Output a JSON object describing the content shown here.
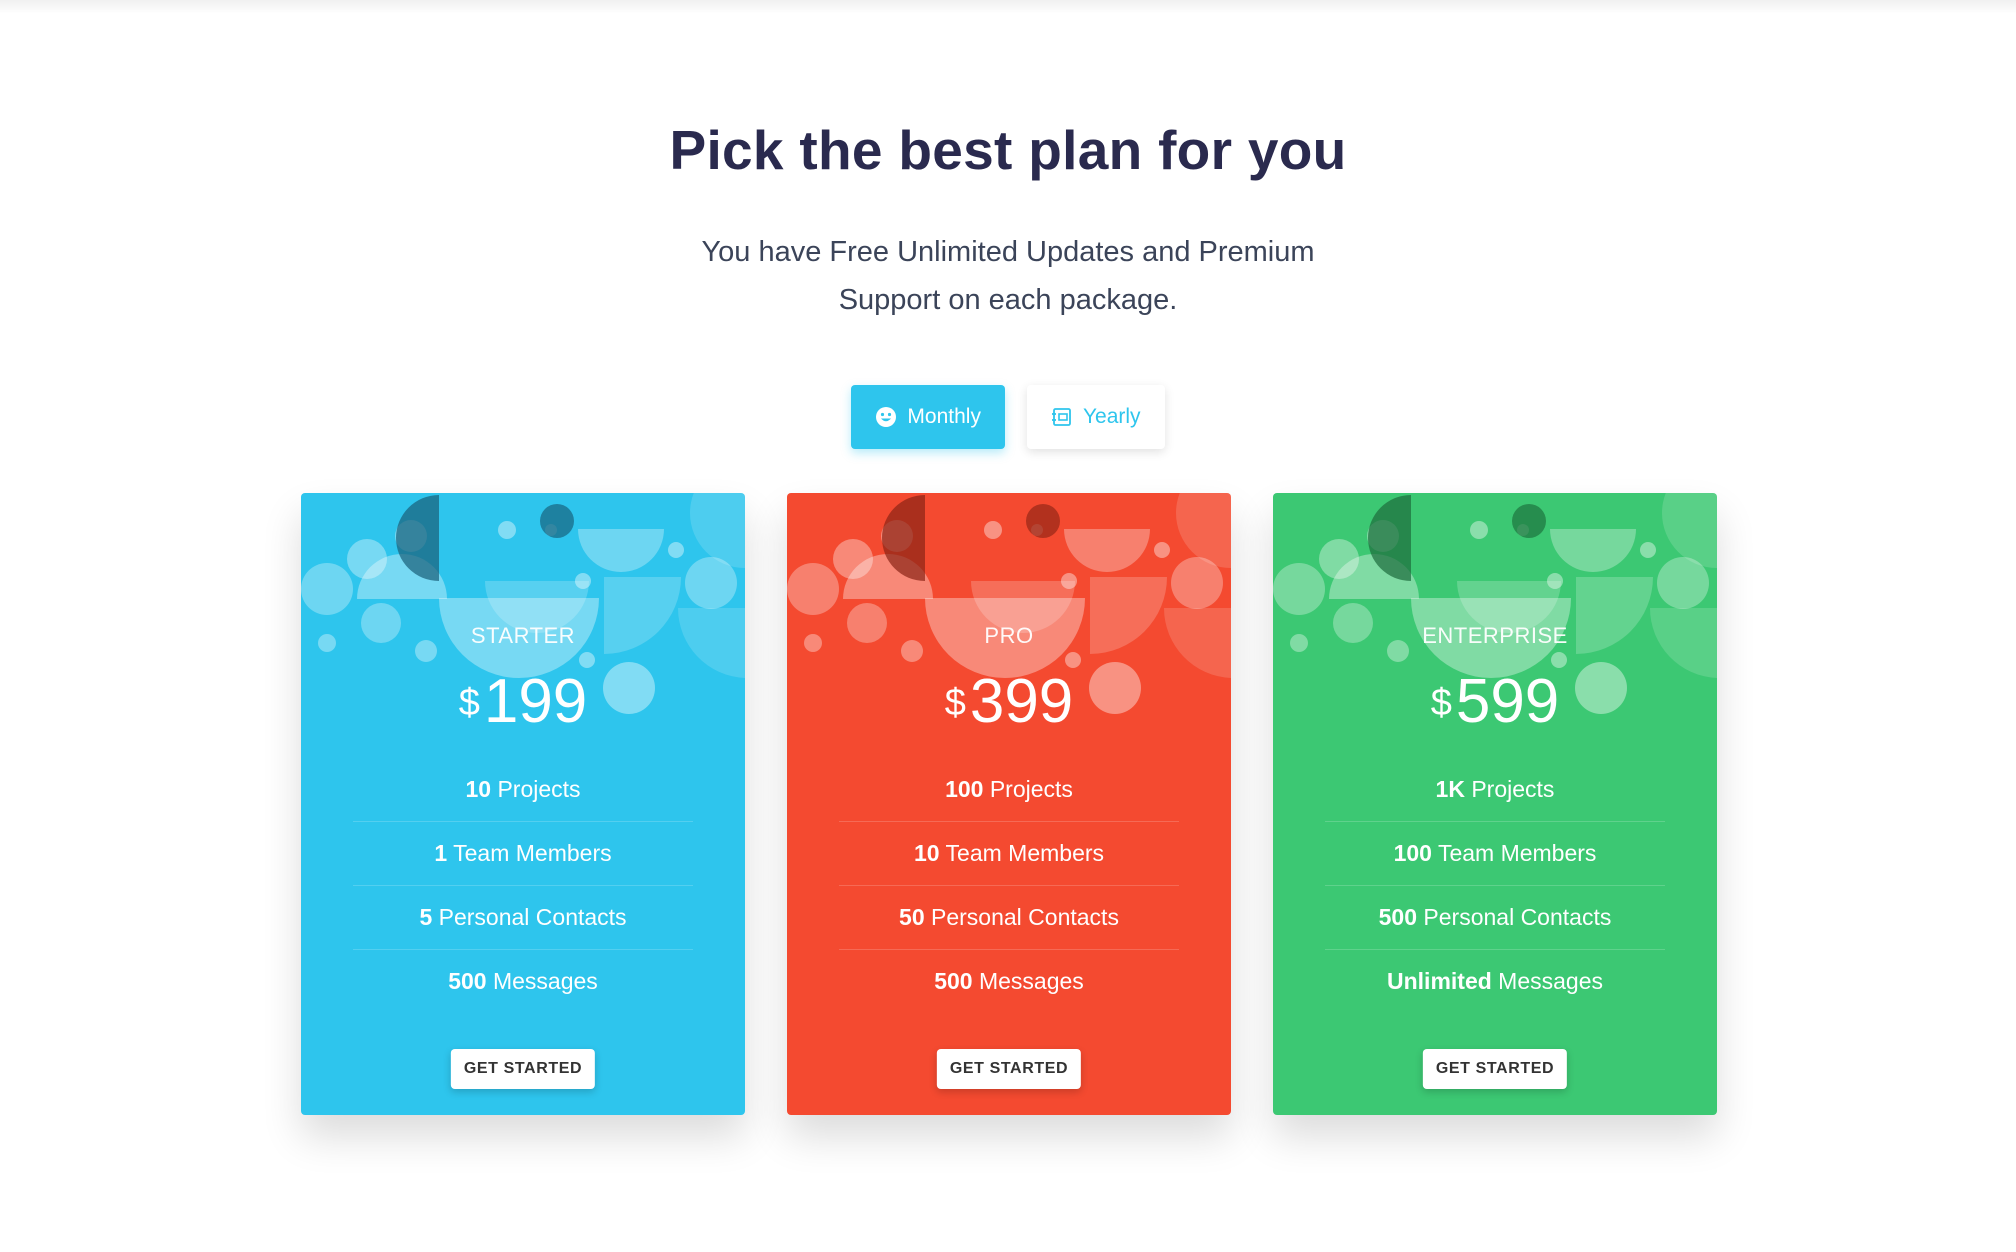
{
  "header": {
    "title": "Pick the best plan for you",
    "subtitle": "You have Free Unlimited Updates and Premium Support on each package."
  },
  "billing_toggle": {
    "options": [
      {
        "label": "Monthly",
        "icon": "smiley-icon",
        "active": true
      },
      {
        "label": "Yearly",
        "icon": "calendar-icon",
        "active": false
      }
    ],
    "active_color": "#2ec5ed"
  },
  "plans": [
    {
      "name": "STARTER",
      "currency": "$",
      "price": "199",
      "color": "#2ec5ed",
      "features": [
        {
          "value": "10",
          "label": "Projects"
        },
        {
          "value": "1",
          "label": "Team Members"
        },
        {
          "value": "5",
          "label": "Personal Contacts"
        },
        {
          "value": "500",
          "label": "Messages"
        }
      ],
      "cta": "GET STARTED"
    },
    {
      "name": "PRO",
      "currency": "$",
      "price": "399",
      "color": "#f44a30",
      "features": [
        {
          "value": "100",
          "label": "Projects"
        },
        {
          "value": "10",
          "label": "Team Members"
        },
        {
          "value": "50",
          "label": "Personal Contacts"
        },
        {
          "value": "500",
          "label": "Messages"
        }
      ],
      "cta": "GET STARTED"
    },
    {
      "name": "ENTERPRISE",
      "currency": "$",
      "price": "599",
      "color": "#3cc873",
      "features": [
        {
          "value": "1K",
          "label": "Projects"
        },
        {
          "value": "100",
          "label": "Team Members"
        },
        {
          "value": "500",
          "label": "Personal Contacts"
        },
        {
          "value": "Unlimited",
          "label": "Messages"
        }
      ],
      "cta": "GET STARTED"
    }
  ]
}
